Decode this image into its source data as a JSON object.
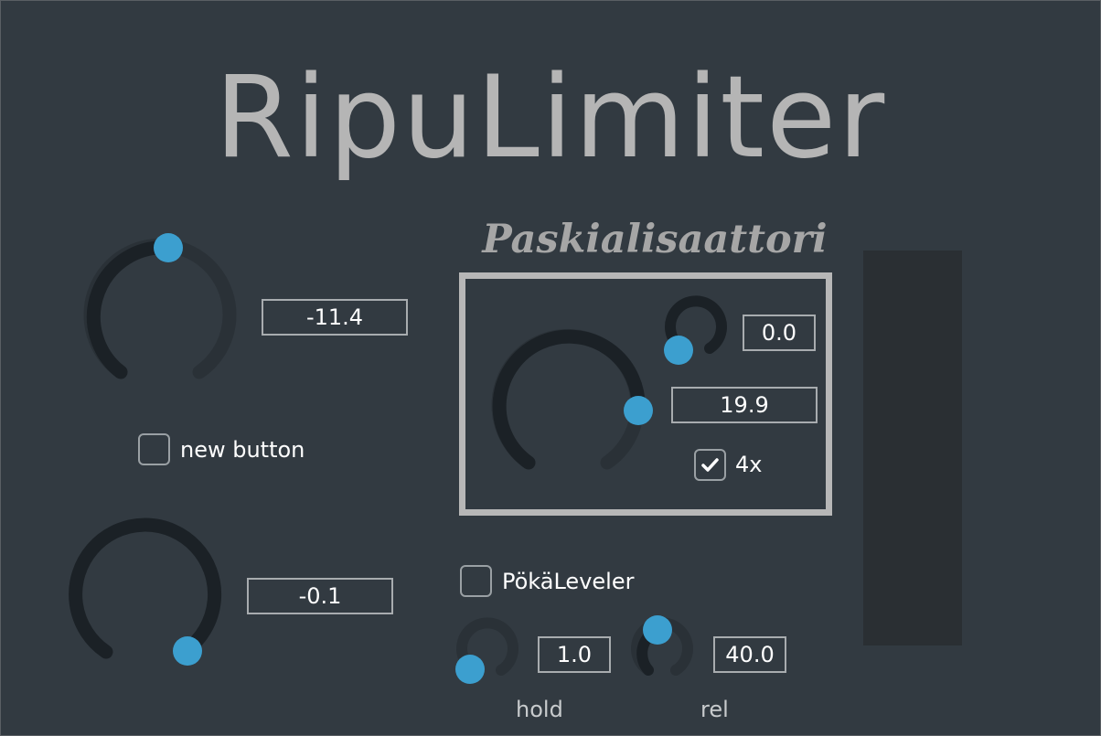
{
  "app": {
    "title": "RipuLimiter",
    "subtitle": "Paskialisaattori"
  },
  "colors": {
    "background": "#323a41",
    "knob_track": "#1b2126",
    "knob_inactive": "#2a3137",
    "knob_thumb": "#3c9fcf",
    "text": "#ffffff",
    "title_text": "#b5b5b5",
    "frame": "#b7b7b7"
  },
  "left": {
    "knob1_value": "-11.4",
    "knob2_value": "-0.1",
    "new_button_label": "new button",
    "new_button_checked": false
  },
  "paskialisaattori": {
    "small_knob_value": "0.0",
    "big_knob_value": "19.9",
    "oversample_label": "4x",
    "oversample_checked": true
  },
  "leveler": {
    "label": "PökäLeveler",
    "checked": false,
    "hold_value": "1.0",
    "hold_label": "hold",
    "rel_value": "40.0",
    "rel_label": "rel"
  }
}
